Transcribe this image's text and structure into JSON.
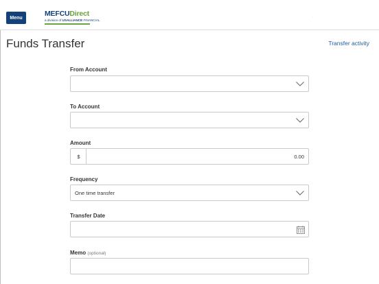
{
  "header": {
    "menu_label": "Menu",
    "logo": {
      "brand_part1": "MEFCU",
      "brand_part2": "Direct",
      "tagline_prefix": "a division of ",
      "tagline_brand1": "US",
      "tagline_brand2": "ALLIANCE",
      "tagline_small": "FINANCIAL"
    },
    "colors": {
      "menu_bg": "#13417a",
      "brand_blue": "#13417a",
      "brand_green": "#6aa339",
      "link": "#1f5b9c"
    }
  },
  "page": {
    "title": "Funds Transfer",
    "activity_link": "Transfer activity"
  },
  "form": {
    "from_account": {
      "label": "From Account",
      "value": ""
    },
    "to_account": {
      "label": "To Account",
      "value": ""
    },
    "amount": {
      "label": "Amount",
      "currency": "$",
      "value": "0.00"
    },
    "frequency": {
      "label": "Frequency",
      "value": "One time transfer"
    },
    "transfer_date": {
      "label": "Transfer Date",
      "value": ""
    },
    "memo": {
      "label": "Memo",
      "optional_label": "(optional)",
      "value": ""
    }
  },
  "icons": [
    "ellipsis-icon",
    "chevron-down-icon",
    "calendar-icon"
  ]
}
